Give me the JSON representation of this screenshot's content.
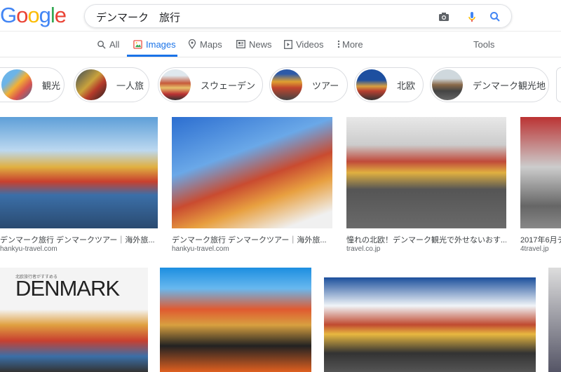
{
  "logo": "Google",
  "search": {
    "query": "デンマーク　旅行",
    "icons": [
      "camera-icon",
      "mic-icon",
      "search-icon"
    ]
  },
  "nav": {
    "tabs": [
      {
        "label": "All",
        "icon": "search-icon"
      },
      {
        "label": "Images",
        "icon": "image-icon",
        "active": true
      },
      {
        "label": "Maps",
        "icon": "map-pin-icon"
      },
      {
        "label": "News",
        "icon": "news-icon"
      },
      {
        "label": "Videos",
        "icon": "play-icon"
      },
      {
        "label": "More",
        "icon": "dots-vertical-icon"
      }
    ],
    "tools": "Tools"
  },
  "chips": [
    "観光",
    "一人旅",
    "スウェーデン",
    "ツアー",
    "北欧",
    "デンマーク観光地"
  ],
  "results": [
    {
      "caption": "デンマーク旅行 デンマークツアー｜海外旅...",
      "domain": "hankyu-travel.com"
    },
    {
      "caption": "デンマーク旅行 デンマークツアー｜海外旅...",
      "domain": "hankyu-travel.com"
    },
    {
      "caption": "憧れの北欧！デンマーク観光で外せないおす...",
      "domain": "travel.co.jp"
    },
    {
      "caption": "2017年6月デ",
      "domain": "4travel.jp"
    }
  ],
  "row2": {
    "image_text": "DENMARK",
    "image_subtext": "北欧旅行者がすすめる"
  },
  "colors": {
    "accent": "#1a73e8",
    "blue": "#4285f4",
    "red": "#ea4335",
    "yellow": "#fbbc05",
    "green": "#34a853"
  }
}
